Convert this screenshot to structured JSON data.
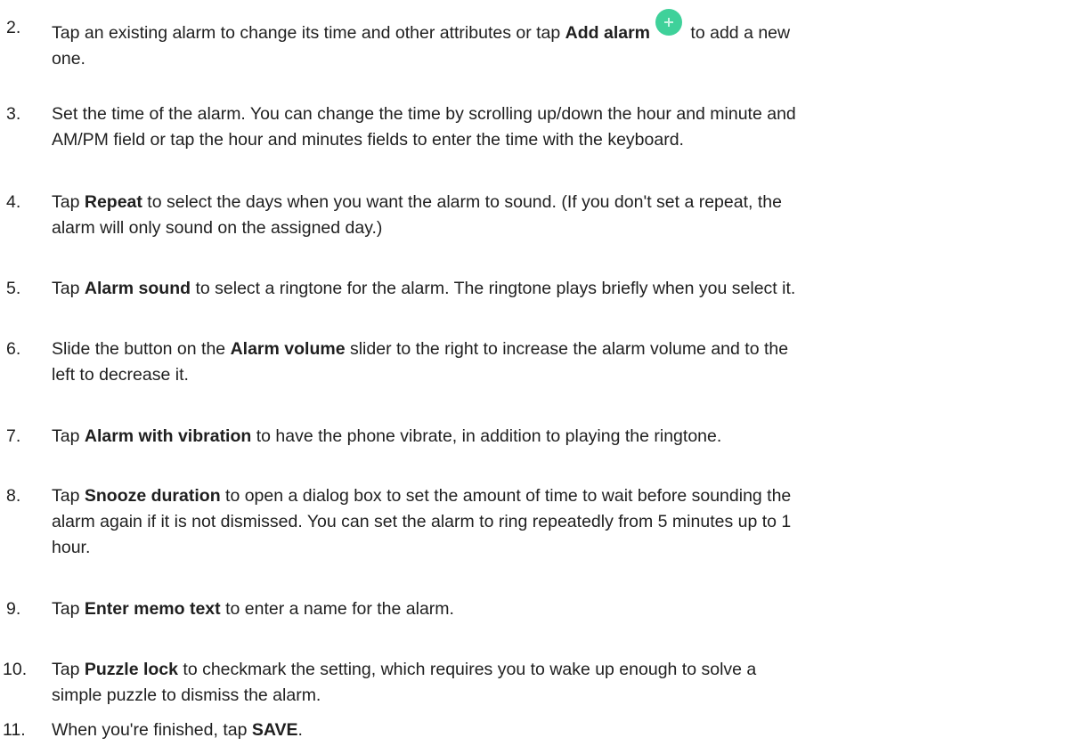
{
  "steps": [
    {
      "num": "2.",
      "pre": "Tap an existing alarm to change its time and other attributes or tap ",
      "bold": "Add alarm",
      "post_line1": " to add a new",
      "post_line2": "one.",
      "icon": "add-circle-icon",
      "icon_color": "#3fd19a"
    },
    {
      "num": "3.",
      "line1": "Set the time of the alarm. You can change the time by scrolling up/down the hour and minute and",
      "line2": "AM/PM field or tap the hour and minutes fields to enter the time with the keyboard."
    },
    {
      "num": "4.",
      "pre": "Tap ",
      "bold": "Repeat",
      "post_line1": " to select the days when you want the alarm to sound. (If you don't set a repeat, the",
      "post_line2": "alarm will only sound on the assigned day.)"
    },
    {
      "num": "5.",
      "pre": "Tap ",
      "bold": "Alarm sound",
      "post": " to select a ringtone for the alarm. The ringtone plays briefly when you select it."
    },
    {
      "num": "6.",
      "pre": "Slide the button on the ",
      "bold": "Alarm volume",
      "post_line1": " slider to the right to increase the alarm volume and to the",
      "post_line2": "left to decrease it."
    },
    {
      "num": "7.",
      "pre": "Tap ",
      "bold": "Alarm with vibration",
      "post": " to have the phone vibrate, in addition to playing the ringtone."
    },
    {
      "num": "8.",
      "pre": "Tap ",
      "bold": "Snooze duration",
      "post_line1": " to open a dialog box to set the amount of time to wait before sounding the",
      "post_line2": "alarm again if it is not dismissed. You can set the alarm to ring repeatedly from 5 minutes up to 1",
      "post_line3": "hour."
    },
    {
      "num": "9.",
      "pre": "Tap ",
      "bold": "Enter memo text",
      "post": " to enter a name for the alarm."
    },
    {
      "num": "10.",
      "pre": "Tap ",
      "bold": "Puzzle lock",
      "post_line1": " to checkmark the setting, which requires you to wake up enough to solve a",
      "post_line2": "simple puzzle to dismiss the alarm."
    },
    {
      "num": "11.",
      "pre": "When you're finished, tap ",
      "bold": "SAVE",
      "post": "."
    }
  ]
}
